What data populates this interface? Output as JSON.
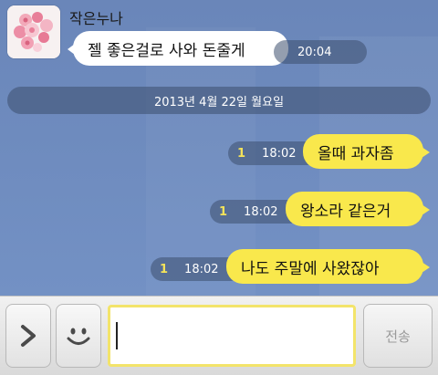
{
  "chat": {
    "sender_name": "작은누나",
    "incoming": {
      "text": "젤 좋은걸로 사와 돈줄게",
      "time": "20:04"
    },
    "date_divider": "2013년 4월 22일 월요일",
    "outgoing": [
      {
        "text": "올때 과자좀",
        "time": "18:02",
        "unread": "1"
      },
      {
        "text": "왕소라 같은거",
        "time": "18:02",
        "unread": "1"
      },
      {
        "text": "나도 주말에 사왔잖아",
        "time": "18:02",
        "unread": "1"
      }
    ]
  },
  "input_bar": {
    "expand_icon": "chevron-right-icon",
    "emoticon_icon": "smiley-icon",
    "message_value": "",
    "send_label": "전송"
  },
  "colors": {
    "chat_background": "#6f8bbd",
    "outgoing_bubble": "#f9e84c",
    "incoming_bubble": "#ffffff",
    "unread_count": "#f4e35a",
    "input_border": "#f3e46a"
  }
}
